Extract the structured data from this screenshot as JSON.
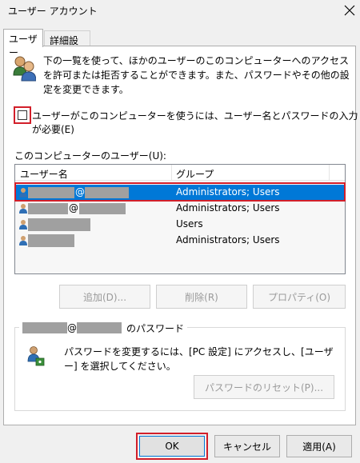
{
  "window": {
    "title": "ユーザー アカウント"
  },
  "tabs": [
    {
      "label": "ユーザー"
    },
    {
      "label": "詳細設定"
    }
  ],
  "info": {
    "text": "下の一覧を使って、ほかのユーザーのこのコンピューターへのアクセスを許可または拒否することができます。また、パスワードやその他の設定を変更できます。"
  },
  "require_login": {
    "label": "ユーザーがこのコンピューターを使うには、ユーザー名とパスワードの入力が必要(E)",
    "checked": false
  },
  "users": {
    "label": "このコンピューターのユーザー(U):",
    "columns": [
      "ユーザー名",
      "グループ"
    ],
    "rows": [
      {
        "name_sep": "@",
        "group": "Administrators; Users",
        "selected": true
      },
      {
        "name_sep": "@",
        "group": "Administrators; Users",
        "selected": false
      },
      {
        "name_sep": "",
        "group": "Users",
        "selected": false
      },
      {
        "name_sep": "",
        "group": "Administrators; Users",
        "selected": false
      }
    ]
  },
  "list_buttons": {
    "add": "追加(D)...",
    "delete": "削除(R)",
    "properties": "プロパティ(O)"
  },
  "password": {
    "group_at": "@",
    "group_suffix": "のパスワード",
    "text": "パスワードを変更するには、[PC 設定] にアクセスし、[ユーザー] を選択してください。",
    "reset": "パスワードのリセット(P)..."
  },
  "footer": {
    "ok": "OK",
    "cancel": "キャンセル",
    "apply": "適用(A)"
  }
}
